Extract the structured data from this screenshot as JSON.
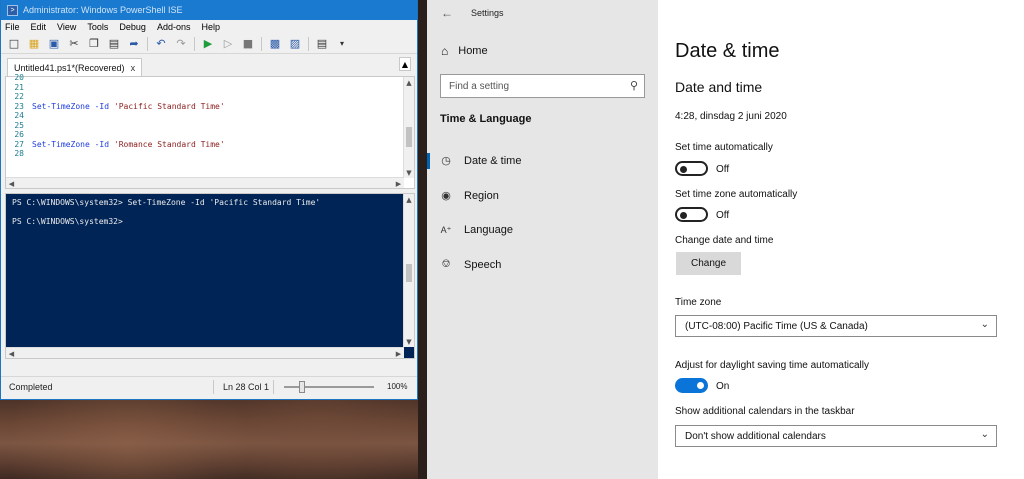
{
  "ise": {
    "title": "Administrator: Windows PowerShell ISE",
    "menu": [
      "File",
      "Edit",
      "View",
      "Tools",
      "Debug",
      "Add-ons",
      "Help"
    ],
    "tab": {
      "label": "Untitled41.ps1*(Recovered)",
      "close": "x"
    },
    "editor_lines": [
      {
        "num": "20",
        "cmd": "",
        "arg": ""
      },
      {
        "num": "21",
        "cmd": "",
        "arg": ""
      },
      {
        "num": "22",
        "cmd": "",
        "arg": ""
      },
      {
        "num": "23",
        "cmd": "Set-TimeZone -Id ",
        "arg": "'Pacific Standard Time'"
      },
      {
        "num": "24",
        "cmd": "",
        "arg": ""
      },
      {
        "num": "25",
        "cmd": "",
        "arg": ""
      },
      {
        "num": "26",
        "cmd": "",
        "arg": ""
      },
      {
        "num": "27",
        "cmd": "Set-TimeZone -Id ",
        "arg": "'Romance Standard Time'"
      },
      {
        "num": "28",
        "cmd": "",
        "arg": ""
      }
    ],
    "console_lines": [
      "PS C:\\WINDOWS\\system32> Set-TimeZone -Id 'Pacific Standard Time'",
      "PS C:\\WINDOWS\\system32>"
    ],
    "status": {
      "text": "Completed",
      "position": "Ln 28  Col 1",
      "zoom": "100%",
      "zoom_level": 0.2
    }
  },
  "settings": {
    "app_title": "Settings",
    "home": "Home",
    "search_placeholder": "Find a setting",
    "section": "Time & Language",
    "nav": [
      {
        "label": "Date & time",
        "icon": "calendar-clock-icon",
        "active": true
      },
      {
        "label": "Region",
        "icon": "globe-icon",
        "active": false
      },
      {
        "label": "Language",
        "icon": "language-icon",
        "active": false
      },
      {
        "label": "Speech",
        "icon": "microphone-icon",
        "active": false
      }
    ],
    "main": {
      "page_title": "Date & time",
      "subtitle": "Date and time",
      "current_datetime": "4:28, dinsdag 2 juni 2020",
      "auto_time": {
        "label": "Set time automatically",
        "state": "Off",
        "on": false
      },
      "auto_timezone": {
        "label": "Set time zone automatically",
        "state": "Off",
        "on": false
      },
      "change": {
        "label": "Change date and time",
        "button": "Change"
      },
      "timezone": {
        "label": "Time zone",
        "value": "(UTC-08:00) Pacific Time (US & Canada)"
      },
      "dst": {
        "label": "Adjust for daylight saving time automatically",
        "state": "On",
        "on": true
      },
      "calendars": {
        "label": "Show additional calendars in the taskbar",
        "value": "Don't show additional calendars"
      }
    },
    "accent_color": "#0a74d8"
  }
}
